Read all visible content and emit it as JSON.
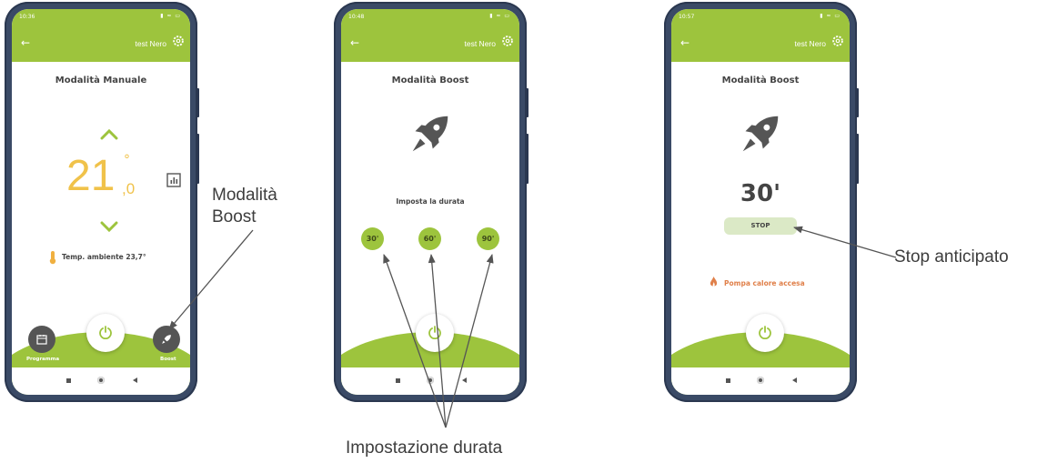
{
  "colors": {
    "accent": "#9dc43d",
    "frame": "#3a4a66",
    "temp": "#f0c24a",
    "warning": "#e0804a"
  },
  "screens": [
    {
      "status_time": "10:36",
      "device_name": "test Nero",
      "title": "Modalità Manuale",
      "temperature_int": "21",
      "temperature_dec": ",0",
      "temperature_deg": "°",
      "ambient_text": "Temp. ambiente 23,7°",
      "nav_left_label": "Programma",
      "nav_right_label": "Boost"
    },
    {
      "status_time": "10:48",
      "device_name": "test Nero",
      "title": "Modalità Boost",
      "duration_label": "Imposta la durata",
      "durations": [
        "30'",
        "60'",
        "90'"
      ]
    },
    {
      "status_time": "10:57",
      "device_name": "test Nero",
      "title": "Modalità Boost",
      "countdown": "30'",
      "stop_label": "STOP",
      "pump_status": "Pompa calore accesa"
    }
  ],
  "annotations": {
    "boost_line1": "Modalità",
    "boost_line2": "Boost",
    "durations": "Impostazione durata",
    "stop": "Stop anticipato"
  },
  "icons": [
    "back-arrow-icon",
    "gear-icon",
    "chevron-up-icon",
    "chevron-down-icon",
    "chart-icon",
    "thermometer-icon",
    "power-icon",
    "calendar-icon",
    "rocket-icon",
    "flame-icon"
  ]
}
